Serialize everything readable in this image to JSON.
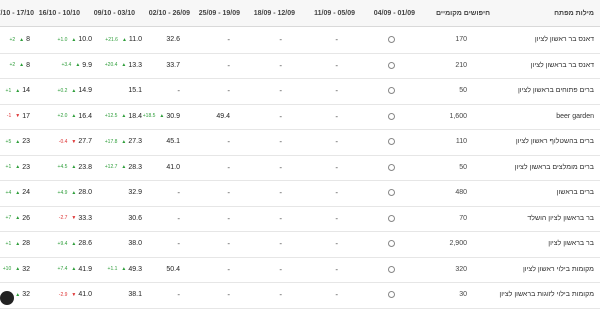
{
  "columns": {
    "keyword": "מילות מפתח",
    "volume": "חיפושים מקומיים",
    "weeks": [
      "04/09 - 01/09",
      "11/09 - 05/09",
      "18/09 - 12/09",
      "25/09 - 19/09",
      "02/10 - 26/09",
      "09/10 - 03/10",
      "16/10 - 10/10",
      "17/10 - 17/10"
    ]
  },
  "rows": [
    {
      "keyword": "דאנס בר ראשון לציון",
      "volume": "170",
      "w1": "circle",
      "w2": "-",
      "w3": "-",
      "w4": "-",
      "w5": "32.6",
      "w6": {
        "v": "11.0",
        "d": "+21.6",
        "dir": "up"
      },
      "w7": {
        "v": "10.0",
        "d": "+1.0",
        "dir": "up"
      },
      "w8": {
        "v": "8",
        "d": "+2",
        "dir": "up"
      }
    },
    {
      "keyword": "דאנס בר בראשון לציון",
      "volume": "210",
      "w1": "circle",
      "w2": "-",
      "w3": "-",
      "w4": "-",
      "w5": "33.7",
      "w6": {
        "v": "13.3",
        "d": "+20.4",
        "dir": "up"
      },
      "w7": {
        "v": "9.9",
        "d": "+3.4",
        "dir": "up"
      },
      "w8": {
        "v": "8",
        "d": "+2",
        "dir": "up"
      }
    },
    {
      "keyword": "ברים פתוחים בראשון לציון",
      "volume": "50",
      "w1": "circle",
      "w2": "-",
      "w3": "-",
      "w4": "-",
      "w5": "-",
      "w6": {
        "v": "15.1",
        "d": "",
        "dir": ""
      },
      "w7": {
        "v": "14.9",
        "d": "+0.2",
        "dir": "up"
      },
      "w8": {
        "v": "14",
        "d": "+1",
        "dir": "up"
      }
    },
    {
      "keyword": "beer garden",
      "volume": "1,600",
      "w1": "circle",
      "w2": "-",
      "w3": "-",
      "w4": "49.4",
      "w5": {
        "v": "30.9",
        "d": "+18.5",
        "dir": "up"
      },
      "w6": {
        "v": "18.4",
        "d": "+12.5",
        "dir": "up"
      },
      "w7": {
        "v": "16.4",
        "d": "+2.0",
        "dir": "up"
      },
      "w8": {
        "v": "17",
        "d": "-1",
        "dir": "down"
      }
    },
    {
      "keyword": "ברים בהשטלוף ראשון לציון",
      "volume": "110",
      "w1": "circle",
      "w2": "-",
      "w3": "-",
      "w4": "-",
      "w5": "45.1",
      "w6": {
        "v": "27.3",
        "d": "+17.8",
        "dir": "up"
      },
      "w7": {
        "v": "27.7",
        "d": "-0.4",
        "dir": "down"
      },
      "w8": {
        "v": "23",
        "d": "+5",
        "dir": "up"
      }
    },
    {
      "keyword": "ברים מומלצים בראשון לציון",
      "volume": "50",
      "w1": "circle",
      "w2": "-",
      "w3": "-",
      "w4": "-",
      "w5": "41.0",
      "w6": {
        "v": "28.3",
        "d": "+12.7",
        "dir": "up"
      },
      "w7": {
        "v": "23.8",
        "d": "+4.5",
        "dir": "up"
      },
      "w8": {
        "v": "23",
        "d": "+1",
        "dir": "up"
      }
    },
    {
      "keyword": "ברים בראשון",
      "volume": "480",
      "w1": "circle",
      "w2": "-",
      "w3": "-",
      "w4": "-",
      "w5": "-",
      "w6": {
        "v": "32.9",
        "d": "",
        "dir": ""
      },
      "w7": {
        "v": "28.0",
        "d": "+4.9",
        "dir": "up"
      },
      "w8": {
        "v": "24",
        "d": "+4",
        "dir": "up"
      }
    },
    {
      "keyword": "בר בראשון לציון הושלד",
      "volume": "70",
      "w1": "circle",
      "w2": "-",
      "w3": "-",
      "w4": "-",
      "w5": "-",
      "w6": {
        "v": "30.6",
        "d": "",
        "dir": ""
      },
      "w7": {
        "v": "33.3",
        "d": "-2.7",
        "dir": "down"
      },
      "w8": {
        "v": "26",
        "d": "+7",
        "dir": "up"
      }
    },
    {
      "keyword": "בר בראשון לציון",
      "volume": "2,900",
      "w1": "circle",
      "w2": "-",
      "w3": "-",
      "w4": "-",
      "w5": "-",
      "w6": {
        "v": "38.0",
        "d": "",
        "dir": ""
      },
      "w7": {
        "v": "28.6",
        "d": "+9.4",
        "dir": "up"
      },
      "w8": {
        "v": "28",
        "d": "+1",
        "dir": "up"
      }
    },
    {
      "keyword": "מקומות בילוי ראשון לציון",
      "volume": "320",
      "w1": "circle",
      "w2": "-",
      "w3": "-",
      "w4": "-",
      "w5": "50.4",
      "w6": {
        "v": "49.3",
        "d": "+1.1",
        "dir": "up"
      },
      "w7": {
        "v": "41.9",
        "d": "+7.4",
        "dir": "up"
      },
      "w8": {
        "v": "32",
        "d": "+10",
        "dir": "up"
      }
    },
    {
      "keyword": "מקומות בילוי לזוגות בראשון לציון",
      "volume": "30",
      "w1": "circle",
      "w2": "-",
      "w3": "-",
      "w4": "-",
      "w5": "-",
      "w6": {
        "v": "38.1",
        "d": "",
        "dir": ""
      },
      "w7": {
        "v": "41.0",
        "d": "-2.9",
        "dir": "down"
      },
      "w8": {
        "v": "32",
        "d": "+9",
        "dir": "up"
      }
    }
  ]
}
